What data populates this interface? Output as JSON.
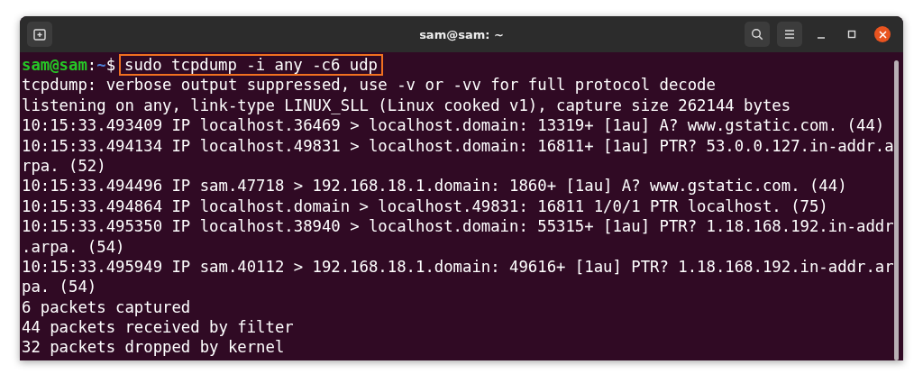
{
  "window": {
    "title": "sam@sam: ~"
  },
  "prompt": {
    "user_host": "sam@sam",
    "separator": ":",
    "path": "~",
    "symbol": "$",
    "command": "sudo tcpdump -i any -c6 udp",
    "highlighted": true
  },
  "output": [
    "tcpdump: verbose output suppressed, use -v or -vv for full protocol decode",
    "listening on any, link-type LINUX_SLL (Linux cooked v1), capture size 262144 bytes",
    "10:15:33.493409 IP localhost.36469 > localhost.domain: 13319+ [1au] A? www.gstatic.com. (44)",
    "10:15:33.494134 IP localhost.49831 > localhost.domain: 16811+ [1au] PTR? 53.0.0.127.in-addr.a",
    "rpa. (52)",
    "10:15:33.494496 IP sam.47718 > 192.168.18.1.domain: 1860+ [1au] A? www.gstatic.com. (44)",
    "10:15:33.494864 IP localhost.domain > localhost.49831: 16811 1/0/1 PTR localhost. (75)",
    "10:15:33.495350 IP localhost.38940 > localhost.domain: 55315+ [1au] PTR? 1.18.168.192.in-addr",
    ".arpa. (54)",
    "10:15:33.495949 IP sam.40112 > 192.168.18.1.domain: 49616+ [1au] PTR? 1.18.168.192.in-addr.ar",
    "pa. (54)",
    "6 packets captured",
    "44 packets received by filter",
    "32 packets dropped by kernel"
  ]
}
